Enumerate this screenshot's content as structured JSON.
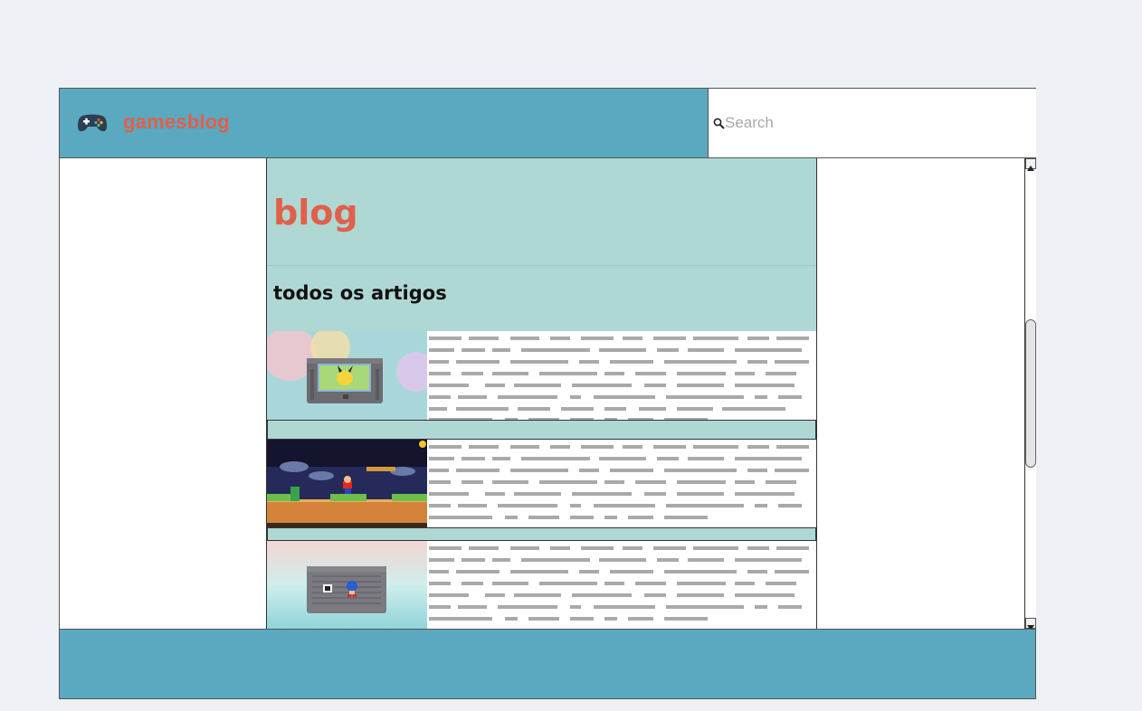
{
  "header": {
    "brand": "gamesblog",
    "logo_icon": "gamepad-icon",
    "search_icon": "search-icon",
    "search_placeholder": "Search",
    "search_value": ""
  },
  "blog": {
    "title": "blog",
    "subtitle": "todos os artigos"
  },
  "articles": [
    {
      "thumbnail": "pikachu-cartridge-image"
    },
    {
      "thumbnail": "mario-game-screenshot-image"
    },
    {
      "thumbnail": "sonic-cartridge-image"
    }
  ],
  "colors": {
    "header_bg": "#5ba8c1",
    "accent": "#e0604a",
    "panel_bg": "#afd8d4",
    "page_bg": "#edf1f5"
  }
}
